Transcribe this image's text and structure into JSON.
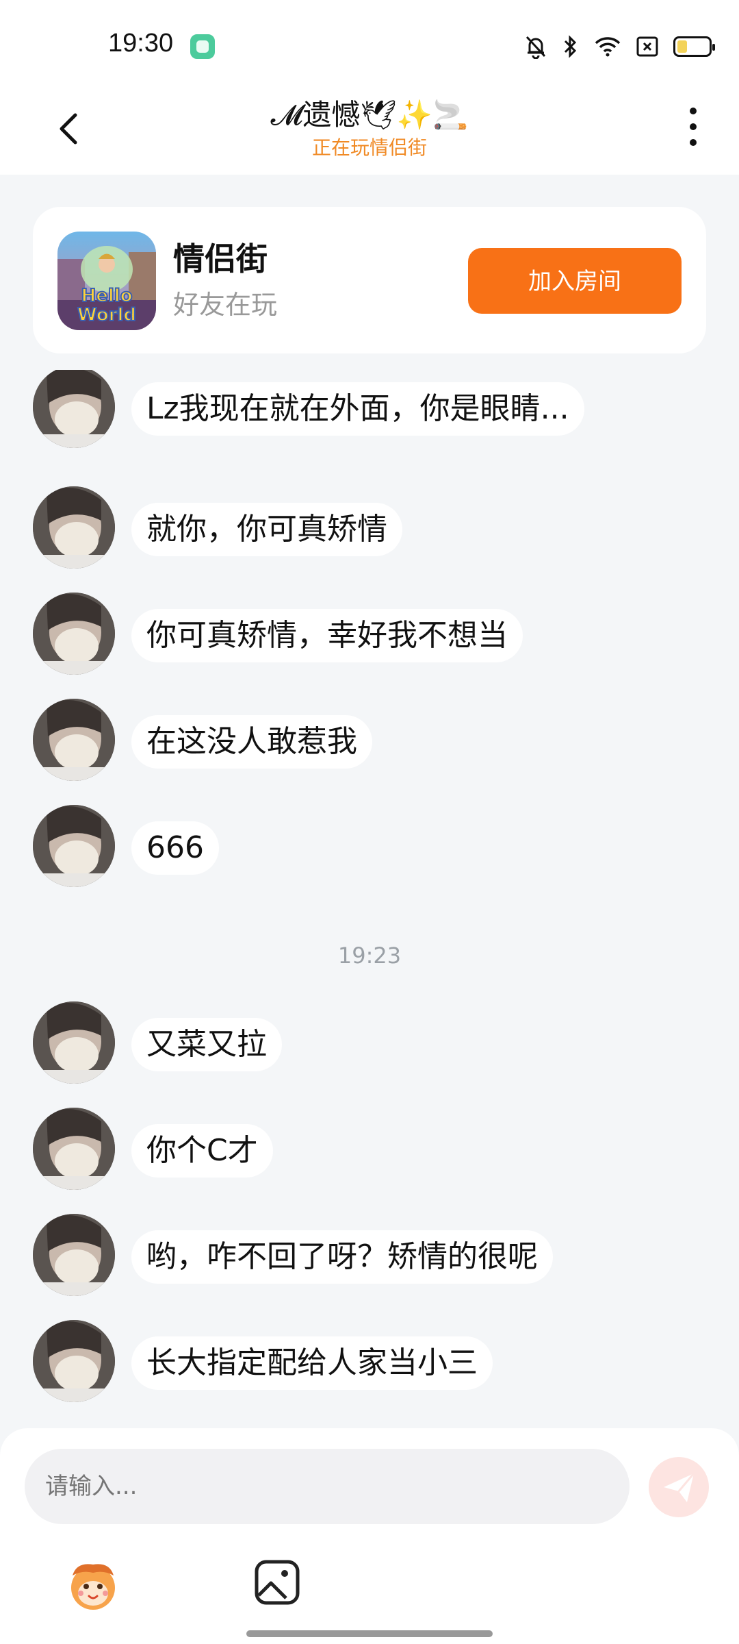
{
  "status_bar": {
    "time": "19:30",
    "icons": [
      "mute-bell-icon",
      "bluetooth-icon",
      "wifi-icon",
      "sim-x-icon",
      "battery-icon"
    ]
  },
  "header": {
    "title": "𝓜遗憾🕊✨🚬",
    "subtitle": "正在玩情侣街"
  },
  "game_card": {
    "name": "情侣街",
    "status": "好友在玩",
    "join_label": "加入房间",
    "icon_text": "Hello World"
  },
  "messages": [
    {
      "text": "Lz我现在就在外面，你是眼睛..."
    },
    {
      "text": "就你，你可真矫情"
    },
    {
      "text": "你可真矫情，幸好我不想当"
    },
    {
      "text": "在这没人敢惹我"
    },
    {
      "text": "666"
    },
    {
      "text": "又菜又拉"
    },
    {
      "text": "你个C才"
    },
    {
      "text": "哟，咋不回了呀？矫情的很呢"
    },
    {
      "text": "长大指定配给人家当小三"
    }
  ],
  "timestamp": "19:23",
  "input": {
    "placeholder": "请输入..."
  },
  "colors": {
    "accent_orange": "#f87116",
    "subtitle_orange": "#f08a25",
    "background": "#f4f6f8",
    "send_disabled": "#fde4e1"
  }
}
